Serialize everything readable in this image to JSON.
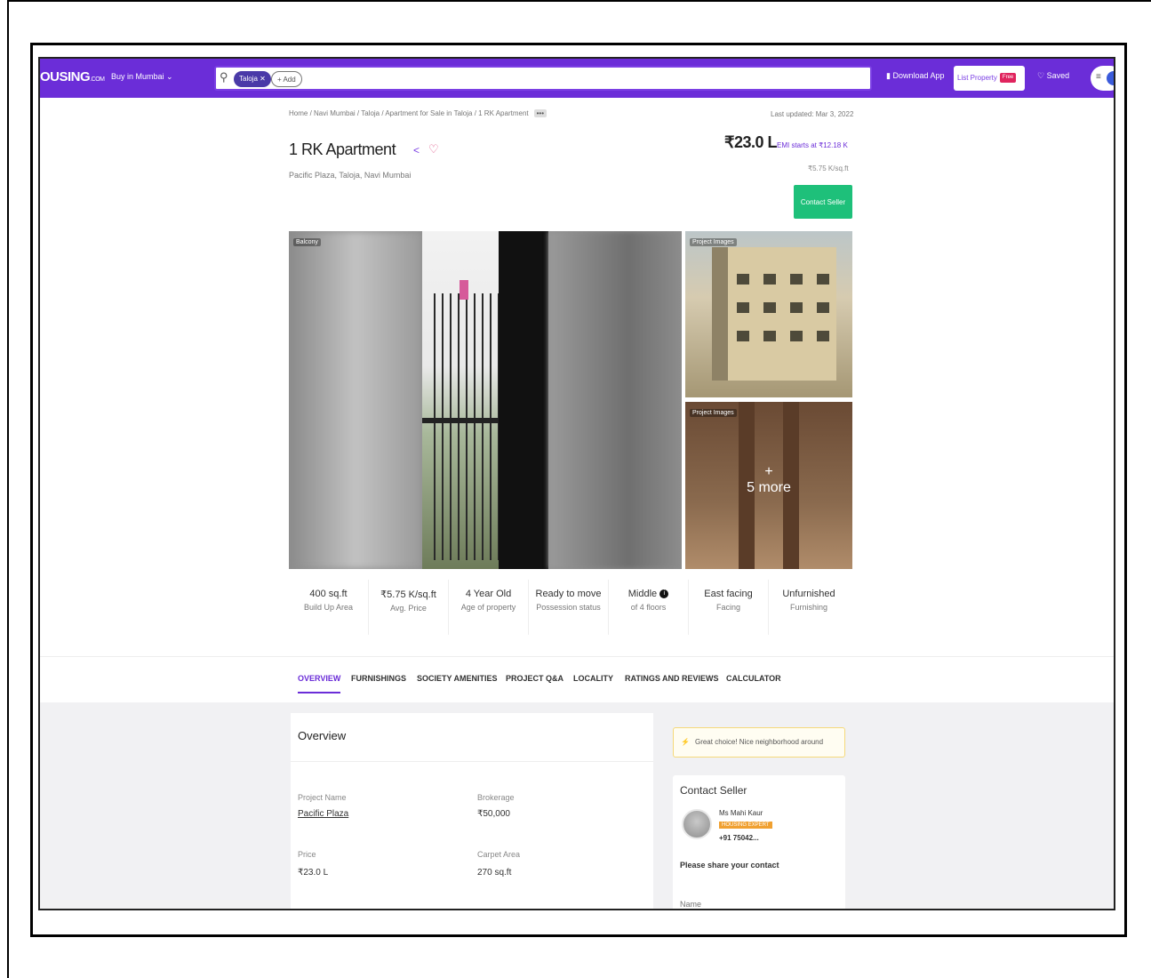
{
  "nav": {
    "logo": "OUSING",
    "logo_suffix": ".COM",
    "city_select": "Buy in Mumbai",
    "search_chip": "Taloja",
    "search_add": "+ Add",
    "download_app": "Download App",
    "list_property": "List Property",
    "free_badge": "Free",
    "saved": "Saved"
  },
  "breadcrumb": "Home / Navi Mumbai / Taloja / Apartment for Sale in Taloja / 1 RK Apartment",
  "last_updated": "Last updated: Mar 3, 2022",
  "listing": {
    "title": "1 RK Apartment",
    "address": "Pacific Plaza, Taloja, Navi Mumbai",
    "price": "₹23.0 L",
    "emi": "EMI starts at ₹12.18 K",
    "price_per_sqft": "₹5.75 K/sq.ft",
    "contact_button": "Contact Seller"
  },
  "gallery": {
    "main_label": "Balcony",
    "side1_label": "Project Images",
    "side2_label": "Project Images",
    "more_plus": "+",
    "more_label": "5 more"
  },
  "facts": [
    {
      "value": "400 sq.ft",
      "label": "Build Up Area"
    },
    {
      "value": "₹5.75 K/sq.ft",
      "label": "Avg. Price"
    },
    {
      "value": "4 Year Old",
      "label": "Age of property"
    },
    {
      "value": "Ready to move",
      "label": "Possession status"
    },
    {
      "value": "Middle",
      "label": "of 4 floors"
    },
    {
      "value": "East facing",
      "label": "Facing"
    },
    {
      "value": "Unfurnished",
      "label": "Furnishing"
    }
  ],
  "tabs": [
    "OVERVIEW",
    "FURNISHINGS",
    "SOCIETY AMENITIES",
    "PROJECT Q&A",
    "LOCALITY",
    "RATINGS AND REVIEWS",
    "CALCULATOR"
  ],
  "overview": {
    "title": "Overview",
    "project_name_label": "Project Name",
    "project_name": "Pacific Plaza",
    "brokerage_label": "Brokerage",
    "brokerage": "₹50,000",
    "price_label": "Price",
    "price": "₹23.0 L",
    "carpet_label": "Carpet Area",
    "carpet": "270 sq.ft"
  },
  "tip": "Great choice! Nice neighborhood around",
  "contact_card": {
    "title": "Contact Seller",
    "seller_name": "Ms Mahi Kaur",
    "badge": "HOUSING EXPERT",
    "phone": "+91 75042...",
    "share_prompt": "Please share your contact",
    "name_placeholder": "Name"
  }
}
